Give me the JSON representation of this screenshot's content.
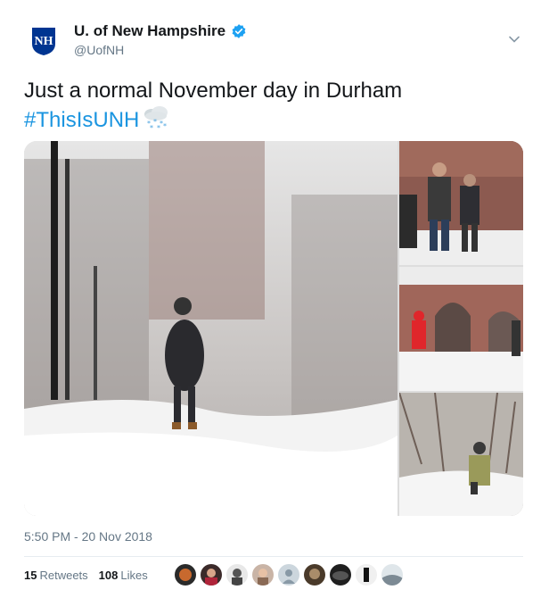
{
  "account": {
    "display_name": "U. of New Hampshire",
    "handle": "@UofNH",
    "logo_letters": "NH",
    "verified_color": "#1da1f2"
  },
  "tweet": {
    "text": "Just a normal November day in Durham",
    "hashtag": "#ThisIsUNH",
    "emoji": "cloud-with-snow-icon"
  },
  "timestamp": "5:50 PM - 20 Nov 2018",
  "stats": {
    "retweets_count": "15",
    "retweets_label": "Retweets",
    "likes_count": "108",
    "likes_label": "Likes"
  },
  "colors": {
    "link": "#1b95e0",
    "secondary_text": "#657786",
    "brand_navy": "#003591"
  }
}
